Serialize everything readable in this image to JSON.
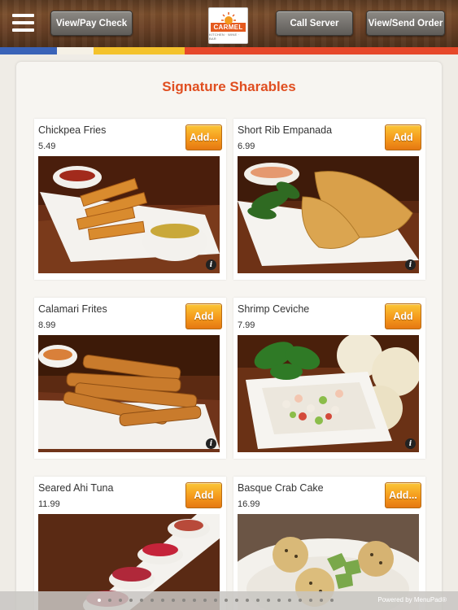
{
  "header": {
    "view_pay_label": "View/Pay Check",
    "call_server_label": "Call Server",
    "view_send_order_label": "View/Send Order",
    "logo_word": "CARMEL",
    "logo_tagline": "KITCHEN · WINE · BAR"
  },
  "colors": {
    "accent_title": "#e04e20",
    "strip": [
      "#3a63b8",
      "#f5f1e6",
      "#f4c22b",
      "#e6482a"
    ]
  },
  "section": {
    "title": "Signature Sharables"
  },
  "items": [
    {
      "name": "Chickpea Fries",
      "price": "5.49",
      "add_label": "Add..."
    },
    {
      "name": "Short Rib Empanada",
      "price": "6.99",
      "add_label": "Add"
    },
    {
      "name": "Calamari Frites",
      "price": "8.99",
      "add_label": "Add"
    },
    {
      "name": "Shrimp Ceviche",
      "price": "7.99",
      "add_label": "Add"
    },
    {
      "name": "Seared Ahi Tuna",
      "price": "11.99",
      "add_label": "Add"
    },
    {
      "name": "Basque Crab Cake",
      "price": "16.99",
      "add_label": "Add..."
    }
  ],
  "info_glyph": "i",
  "footer": {
    "powered_by": "Powered by MenuPad®"
  }
}
